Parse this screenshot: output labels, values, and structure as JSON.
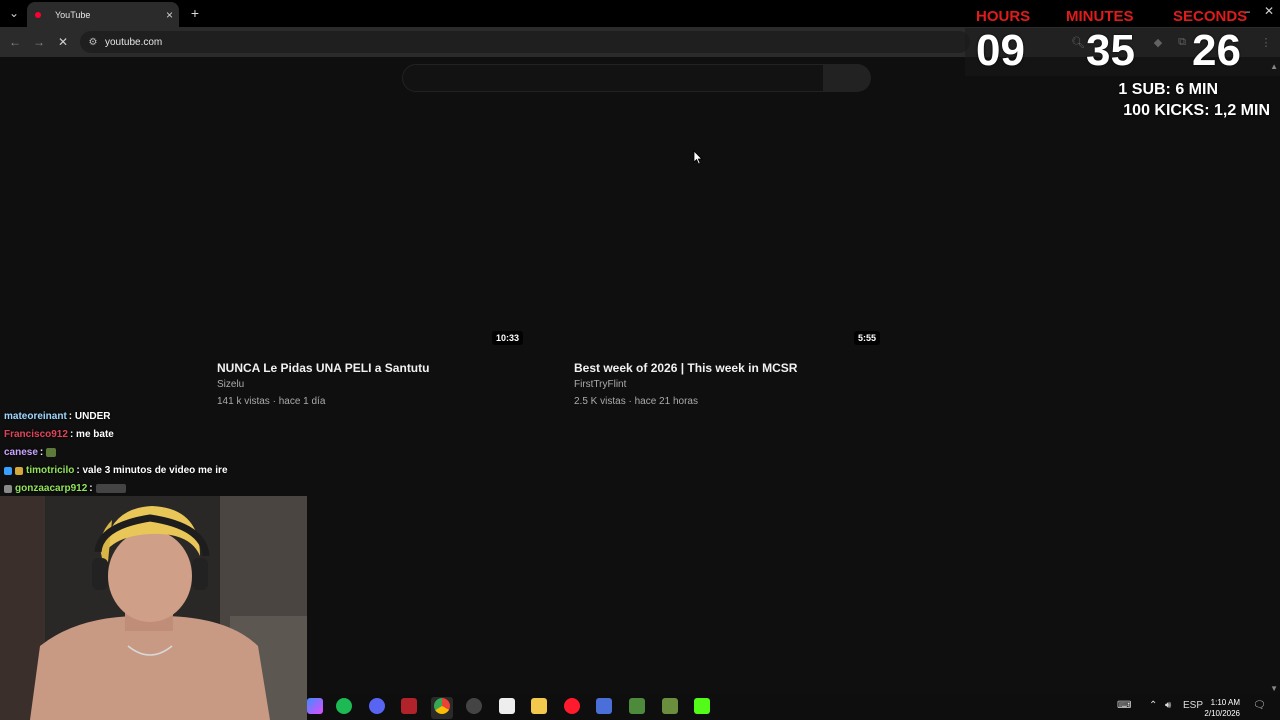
{
  "browser": {
    "tab_title": "YouTube",
    "url": "youtube.com",
    "tab_dropdown_icon": "chevron-down-icon",
    "new_tab_icon": "plus-icon"
  },
  "videos": [
    {
      "title": "NUNCA Le Pidas UNA PELI a Santutu",
      "channel": "Sizelu",
      "meta": "141 k vistas · hace 1 día",
      "duration": "10:33"
    },
    {
      "title": "Best week of 2026 | This week in MCSR",
      "channel": "FirstTryFlint",
      "meta": "2.5 K vistas · hace 21 horas",
      "duration": "5:55"
    }
  ],
  "overlay": {
    "timer": {
      "hours_label": "HOURS",
      "minutes_label": "MINUTES",
      "seconds_label": "SECONDS",
      "hours": "09",
      "minutes": "35",
      "seconds": "26"
    },
    "goals": [
      "1 SUB: 6 MIN",
      "100 KICKS: 1,2 MIN"
    ]
  },
  "chat": [
    {
      "user": "mateoreinant",
      "message": ": UNDER",
      "color": "#9fd8ff"
    },
    {
      "user": "Francisco912",
      "message": ": me bate",
      "color": "#e0445a"
    },
    {
      "user": "canese",
      "message": ":",
      "color": "#c9a5ff"
    },
    {
      "user": "timotricilo",
      "message": ": vale 3 minutos de video me ire",
      "color": "#93e35a"
    },
    {
      "user": "gonzaacarp912",
      "message": ":",
      "color": "#93e35a"
    }
  ],
  "taskbar": {
    "language": "ESP",
    "time": "1:10 AM",
    "date": "2/10/2026"
  },
  "colors": {
    "background": "#0f0f0f",
    "timer_label": "#e01b1b",
    "youtube_red": "#ff0033"
  }
}
